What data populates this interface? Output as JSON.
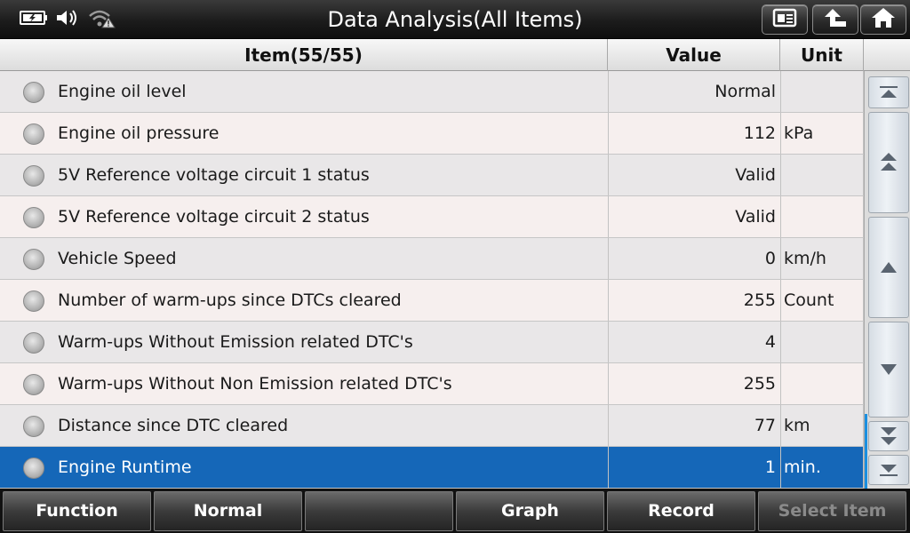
{
  "window": {
    "title": "Data Analysis(All Items)"
  },
  "status_icons": [
    "battery-icon",
    "speaker-icon",
    "wifi-warning-icon"
  ],
  "title_buttons": [
    "report-icon",
    "back-icon",
    "home-icon"
  ],
  "table": {
    "headers": {
      "item": "Item(55/55)",
      "value": "Value",
      "unit": "Unit"
    },
    "rows": [
      {
        "name": "Engine oil level",
        "value": "Normal",
        "unit": ""
      },
      {
        "name": "Engine oil pressure",
        "value": "112",
        "unit": "kPa"
      },
      {
        "name": "5V Reference voltage circuit 1 status",
        "value": "Valid",
        "unit": ""
      },
      {
        "name": "5V Reference voltage circuit 2 status",
        "value": "Valid",
        "unit": ""
      },
      {
        "name": "Vehicle Speed",
        "value": "0",
        "unit": "km/h"
      },
      {
        "name": "Number of warm-ups since DTCs cleared",
        "value": "255",
        "unit": "Count"
      },
      {
        "name": "Warm-ups Without Emission related DTC's",
        "value": "4",
        "unit": ""
      },
      {
        "name": "Warm-ups Without Non Emission related DTC's",
        "value": "255",
        "unit": ""
      },
      {
        "name": "Distance since DTC cleared",
        "value": "77",
        "unit": "km"
      },
      {
        "name": "Engine Runtime",
        "value": "1",
        "unit": "min."
      }
    ],
    "selected_index": 9
  },
  "scrollbar": [
    "scroll-top-icon",
    "page-up-icon",
    "scroll-up-icon",
    "scroll-down-icon",
    "page-down-icon",
    "scroll-bottom-icon"
  ],
  "toolbar": {
    "function": "Function",
    "normal": "Normal",
    "blank": "",
    "graph": "Graph",
    "record": "Record",
    "select_item": "Select Item"
  },
  "colors": {
    "selected_row": "#1567b8",
    "accent": "#1a8fe0"
  }
}
